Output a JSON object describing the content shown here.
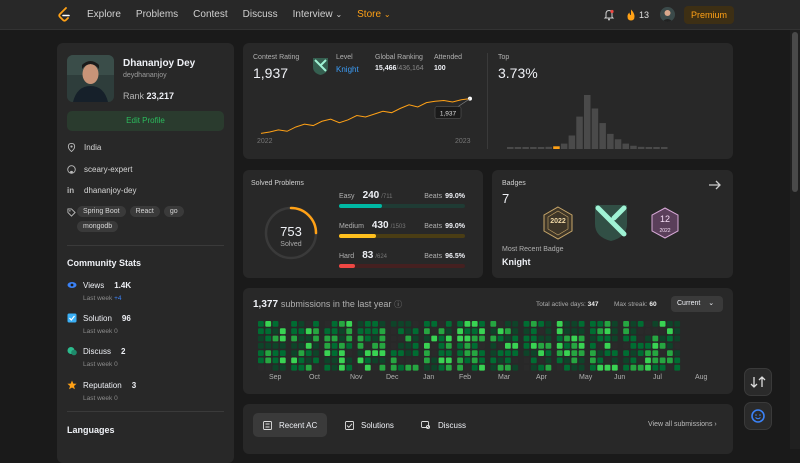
{
  "nav": {
    "items": [
      "Explore",
      "Problems",
      "Contest",
      "Discuss",
      "Interview",
      "Store"
    ],
    "streak": "13",
    "premium": "Premium"
  },
  "profile": {
    "name": "Dhananjoy Dey",
    "handle": "deydhananjoy",
    "rank_label": "Rank",
    "rank": "23,217",
    "edit": "Edit Profile",
    "location": "India",
    "github": "sceary-expert",
    "linkedin": "dhananjoy-dey",
    "skills": [
      "Spring Boot",
      "React",
      "go",
      "mongodb"
    ]
  },
  "community": {
    "title": "Community Stats",
    "views": {
      "label": "Views",
      "value": "1.4K",
      "sub": "Last week",
      "delta": "+4"
    },
    "solution": {
      "label": "Solution",
      "value": "96",
      "sub": "Last week",
      "delta": "0"
    },
    "discuss": {
      "label": "Discuss",
      "value": "2",
      "sub": "Last week",
      "delta": "0"
    },
    "reputation": {
      "label": "Reputation",
      "value": "3",
      "sub": "Last week",
      "delta": "0"
    }
  },
  "languages": {
    "title": "Languages"
  },
  "contest": {
    "rating_label": "Contest Rating",
    "rating": "1,937",
    "level_label": "Level",
    "level": "Knight",
    "global_label": "Global Ranking",
    "global_rank": "15,466",
    "global_total": "/436,164",
    "attended_label": "Attended",
    "attended": "100",
    "top_label": "Top",
    "top": "3.73%",
    "tooltip": "1,937",
    "years": [
      "2022",
      "2023"
    ],
    "colors": {
      "line": "#ffa116"
    }
  },
  "chart_data": {
    "type": "line",
    "x": [
      "2022",
      "2023"
    ],
    "series": [
      {
        "values": [
          1450,
          1470,
          1500,
          1480,
          1540,
          1580,
          1560,
          1620,
          1650,
          1600,
          1640,
          1700,
          1680,
          1720,
          1760,
          1740,
          1800,
          1850,
          1820,
          1880,
          1900,
          1910,
          1890,
          1920,
          1937
        ]
      }
    ],
    "bars": [
      1,
      1,
      1,
      2,
      3,
      4,
      5,
      10,
      25,
      60,
      100,
      75,
      48,
      28,
      18,
      10,
      6,
      4,
      3,
      2,
      1
    ],
    "highlighted_bar_index": 6
  },
  "solved": {
    "title": "Solved Problems",
    "total": "753",
    "total_label": "Solved",
    "easy": {
      "label": "Easy",
      "count": "240",
      "total": "/711",
      "beats_label": "Beats",
      "beats": "99.0%",
      "frac": 0.34,
      "color": "#00b8a3",
      "track": "#1f3b34"
    },
    "medium": {
      "label": "Medium",
      "count": "430",
      "total": "/1503",
      "beats_label": "Beats",
      "beats": "99.0%",
      "frac": 0.29,
      "color": "#ffc01e",
      "track": "#4a3d14"
    },
    "hard": {
      "label": "Hard",
      "count": "83",
      "total": "/624",
      "beats_label": "Beats",
      "beats": "96.5%",
      "frac": 0.13,
      "color": "#ef4743",
      "track": "#452020"
    }
  },
  "badges": {
    "title": "Badges",
    "count": "7",
    "recent_label": "Most Recent Badge",
    "recent": "Knight",
    "b1": "2022",
    "b3": "12",
    "b3_sub": "2022"
  },
  "submissions": {
    "count": "1,377",
    "label": "submissions in the last year",
    "active_label": "Total active days:",
    "active": "347",
    "streak_label": "Max streak:",
    "streak": "60",
    "filter": "Current",
    "months": [
      "Sep",
      "Oct",
      "Nov",
      "Dec",
      "Jan",
      "Feb",
      "Mar",
      "Apr",
      "May",
      "Jun",
      "Jul",
      "Aug"
    ]
  },
  "tabs": {
    "recent": "Recent AC",
    "solutions": "Solutions",
    "discuss": "Discuss",
    "view_all": "View all submissions"
  }
}
